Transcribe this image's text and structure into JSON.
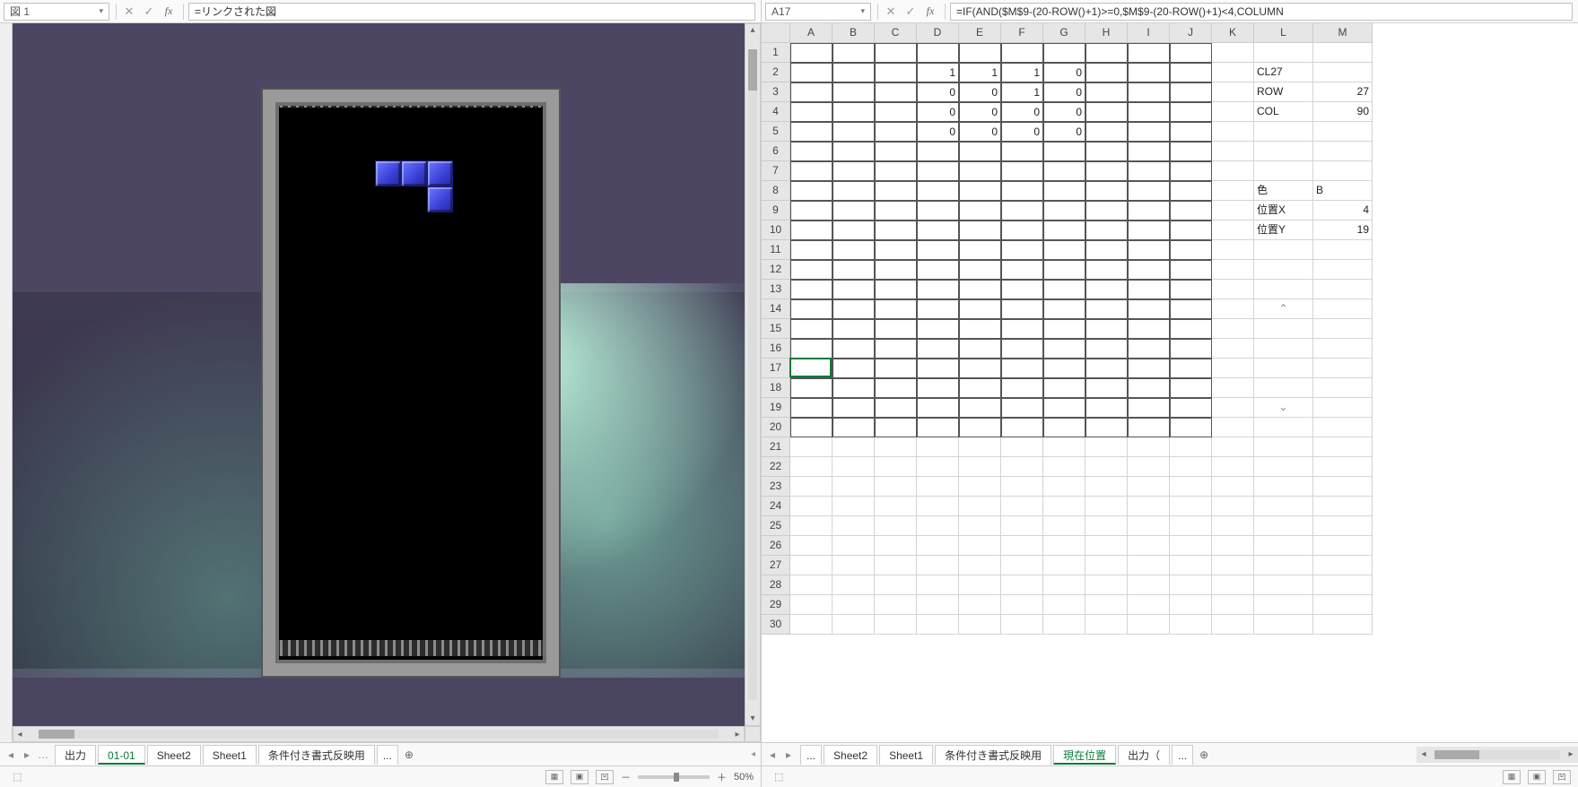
{
  "left": {
    "name_box": "図 1",
    "formula": "=リンクされた図",
    "tabs": [
      "出力",
      "01-01",
      "Sheet2",
      "Sheet1",
      "条件付き書式反映用",
      "..."
    ],
    "active_tab": "01-01",
    "zoom": "50%"
  },
  "right": {
    "name_box": "A17",
    "formula": "=IF(AND($M$9-(20-ROW()+1)>=0,$M$9-(20-ROW()+1)<4,COLUMN",
    "columns": [
      "A",
      "B",
      "C",
      "D",
      "E",
      "F",
      "G",
      "H",
      "I",
      "J",
      "K",
      "L",
      "M"
    ],
    "row_count": 30,
    "selected_cell": {
      "col": "A",
      "row": 17
    },
    "grid_cells": {
      "2": {
        "D": "1",
        "E": "1",
        "F": "1",
        "G": "0"
      },
      "3": {
        "D": "0",
        "E": "0",
        "F": "1",
        "G": "0"
      },
      "4": {
        "D": "0",
        "E": "0",
        "F": "0",
        "G": "0"
      },
      "5": {
        "D": "0",
        "E": "0",
        "F": "0",
        "G": "0"
      }
    },
    "info": {
      "cl_label": "CL27",
      "row_label": "ROW",
      "row_value": "27",
      "col_label": "COL",
      "col_value": "90",
      "color_label": "色",
      "color_value": "B",
      "posx_label": "位置X",
      "posx_value": "4",
      "posy_label": "位置Y",
      "posy_value": "19"
    },
    "tabs": [
      "...",
      "Sheet2",
      "Sheet1",
      "条件付き書式反映用",
      "現在位置",
      "出力（",
      "..."
    ],
    "active_tab": "現在位置",
    "zoom": "100%"
  },
  "chart_data": {
    "type": "table",
    "description": "Right spreadsheet encodes a 4x4 tetromino shape (J-piece) plus position metadata",
    "shape_grid": {
      "row2": [
        1,
        1,
        1,
        0
      ],
      "row3": [
        0,
        0,
        1,
        0
      ],
      "row4": [
        0,
        0,
        0,
        0
      ],
      "row5": [
        0,
        0,
        0,
        0
      ]
    },
    "metadata": {
      "CL": 27,
      "ROW": 27,
      "COL": 90,
      "color": "B",
      "posX": 4,
      "posY": 19
    }
  }
}
